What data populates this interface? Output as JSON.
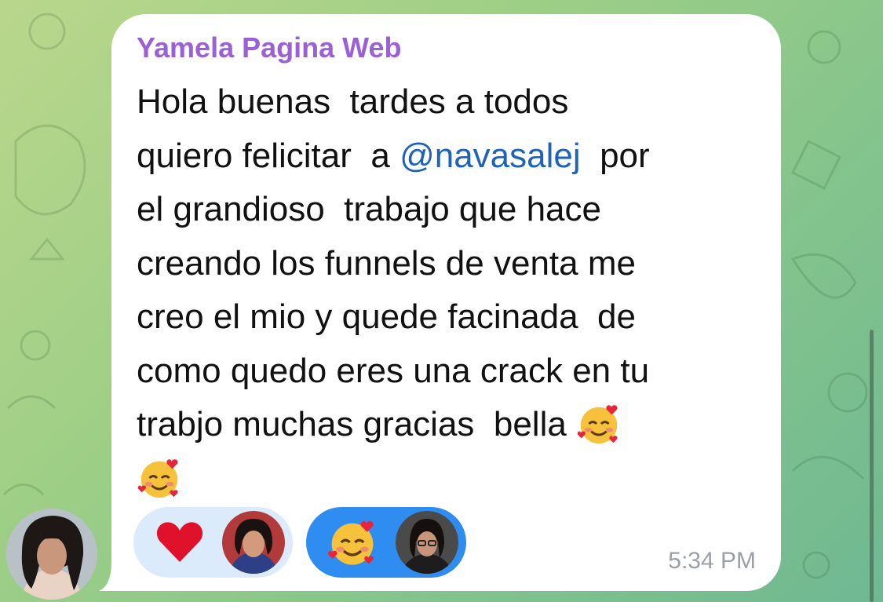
{
  "message": {
    "sender_name": "Yamela Pagina Web",
    "lines": [
      {
        "pre": "Hola buenas  tardes a todos",
        "mention": "",
        "post": ""
      },
      {
        "pre": "quiero felicitar  a ",
        "mention": "@navasalej",
        "post": "  por"
      },
      {
        "pre": "el grandioso  trabajo que hace",
        "mention": "",
        "post": ""
      },
      {
        "pre": "creando los funnels de venta me",
        "mention": "",
        "post": ""
      },
      {
        "pre": "creo el mio y quede facinada  de",
        "mention": "",
        "post": ""
      },
      {
        "pre": "como quedo eres una crack en tu",
        "mention": "",
        "post": ""
      },
      {
        "pre": "trabjo muchas gracias  bella ",
        "mention": "",
        "post": ""
      }
    ],
    "emojis": [
      "smiling-face-with-hearts",
      "smiling-face-with-hearts"
    ],
    "time": "5:34 PM"
  },
  "reactions": [
    {
      "emoji": "red-heart",
      "selected": false
    },
    {
      "emoji": "smiling-face-with-hearts",
      "selected": true
    }
  ],
  "colors": {
    "sender_name": "#9b5fd6",
    "mention": "#1f63b8",
    "reaction_selected_bg": "#2f8cf0",
    "reaction_bg": "#dcebfb",
    "time": "#9aa0a6"
  }
}
